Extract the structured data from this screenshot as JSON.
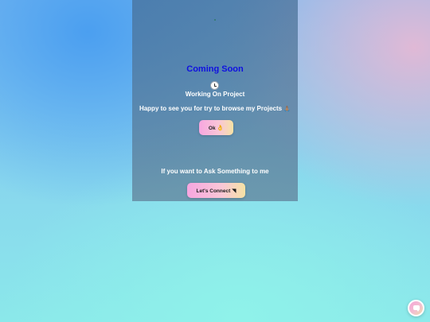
{
  "modal": {
    "title": "Coming Soon",
    "icon": "clock-icon",
    "subtitle": "Working On Project",
    "message": "Happy to see you for try to browse my Projects",
    "message_emoji": "🙏🏽",
    "ok_button": {
      "label": "Ok",
      "emoji": "👌"
    },
    "ask_text": "If you want to Ask Something to me",
    "connect_button": {
      "label": "Let's Connect",
      "emoji": "◥"
    }
  },
  "chat_widget": {
    "icon": "chat-icon"
  },
  "colors": {
    "title": "#1010e0",
    "button_gradient_start": "#f7a6e0",
    "button_gradient_end": "#f6e2a4",
    "background_top_left": "#4b9ff0",
    "background_bottom": "#8be8ea",
    "background_top_right": "#e0b9d6"
  }
}
